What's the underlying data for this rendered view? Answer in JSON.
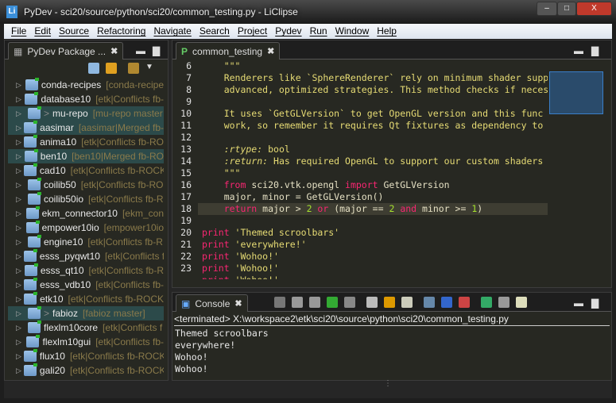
{
  "window": {
    "title": "PyDev - sci20/source/python/sci20/common_testing.py - LiClipse",
    "app_icon": "Li",
    "min": "–",
    "max": "□",
    "close": "X"
  },
  "menu": [
    "File",
    "Edit",
    "Source",
    "Refactoring",
    "Navigate",
    "Search",
    "Project",
    "Pydev",
    "Run",
    "Window",
    "Help"
  ],
  "explorer": {
    "title": "PyDev Package ...",
    "items": [
      {
        "name": "conda-recipes",
        "dec": "[conda-recipe"
      },
      {
        "name": "database10",
        "dec": "[etk|Conflicts fb-"
      },
      {
        "name": "mu-repo",
        "dec": "[mu-repo master",
        "sel": true,
        "gt": ">"
      },
      {
        "name": "aasimar",
        "dec": "[aasimar|Merged fb-",
        "sel": true
      },
      {
        "name": "anima10",
        "dec": "[etk|Conflicts fb-RO"
      },
      {
        "name": "ben10",
        "dec": "[ben10|Merged fb-RO",
        "sel": true
      },
      {
        "name": "cad10",
        "dec": "[etk|Conflicts fb-ROCK"
      },
      {
        "name": "coilib50",
        "dec": "[etk|Conflicts fb-RO"
      },
      {
        "name": "coilib50io",
        "dec": "[etk|Conflicts fb-R"
      },
      {
        "name": "ekm_connector10",
        "dec": "[ekm_con"
      },
      {
        "name": "empower10io",
        "dec": "[empower10io"
      },
      {
        "name": "engine10",
        "dec": "[etk|Conflicts fb-R"
      },
      {
        "name": "esss_pyqwt10",
        "dec": "[etk|Conflicts f"
      },
      {
        "name": "esss_qt10",
        "dec": "[etk|Conflicts fb-R"
      },
      {
        "name": "esss_vdb10",
        "dec": "[etk|Conflicts fb-"
      },
      {
        "name": "etk10",
        "dec": "[etk|Conflicts fb-ROCK"
      },
      {
        "name": "fabioz",
        "dec": "[fabioz master]",
        "sel": true,
        "gt": ">"
      },
      {
        "name": "flexlm10core",
        "dec": "[etk|Conflicts f"
      },
      {
        "name": "flexlm10gui",
        "dec": "[etk|Conflicts fb-"
      },
      {
        "name": "flux10",
        "dec": "[etk|Conflicts fb-ROCK"
      },
      {
        "name": "gali20",
        "dec": "[etk|Conflicts fb-ROCK"
      }
    ]
  },
  "editor": {
    "tab": "common_testing",
    "lines": [
      {
        "n": "6",
        "t": [
          [
            "doc",
            "    \"\"\""
          ]
        ]
      },
      {
        "n": "7",
        "t": [
          [
            "doc",
            "    Renderers like `SphereRenderer` rely on minimum shader supp"
          ]
        ]
      },
      {
        "n": "8",
        "t": [
          [
            "doc",
            "    advanced, optimized strategies. This method checks if neces"
          ]
        ]
      },
      {
        "n": "9",
        "t": []
      },
      {
        "n": "10",
        "t": [
          [
            "doc",
            "    It uses `GetGLVersion` to get OpenGL version and this func"
          ]
        ]
      },
      {
        "n": "11",
        "t": [
          [
            "doc",
            "    work, so remember it requires Qt fixtures as dependency to"
          ]
        ]
      },
      {
        "n": "12",
        "t": []
      },
      {
        "n": "13",
        "t": [
          [
            "it",
            "    :rtype:"
          ],
          [
            "doc",
            " bool"
          ]
        ]
      },
      {
        "n": "14",
        "t": [
          [
            "it",
            "    :return:"
          ],
          [
            "doc",
            " Has required OpenGL to support our custom shaders"
          ]
        ]
      },
      {
        "n": "15",
        "t": [
          [
            "doc",
            "    \"\"\""
          ]
        ]
      },
      {
        "n": "16",
        "t": [
          [
            "kw",
            "    from"
          ],
          [
            "id",
            " sci20.vtk.opengl "
          ],
          [
            "kw",
            "import"
          ],
          [
            "id",
            " GetGLVersion"
          ]
        ]
      },
      {
        "n": "17",
        "t": [
          [
            "id",
            "    major, minor = GetGLVersion()"
          ]
        ]
      },
      {
        "n": "18",
        "cur": true,
        "t": [
          [
            "kw",
            "    return"
          ],
          [
            "id",
            " major > "
          ],
          [
            "num",
            "2"
          ],
          [
            "kw",
            " or"
          ],
          [
            "id",
            " (major == "
          ],
          [
            "num",
            "2"
          ],
          [
            "kw",
            " and"
          ],
          [
            "id",
            " minor >= "
          ],
          [
            "num",
            "1"
          ],
          [
            "id",
            ")"
          ]
        ]
      },
      {
        "n": "19",
        "t": []
      },
      {
        "n": "20",
        "t": [
          [
            "kw",
            "print"
          ],
          [
            "str",
            " 'Themed scroolbars'"
          ]
        ]
      },
      {
        "n": "21",
        "t": [
          [
            "kw",
            "print"
          ],
          [
            "str",
            " 'everywhere!'"
          ]
        ]
      },
      {
        "n": "22",
        "t": [
          [
            "kw",
            "print"
          ],
          [
            "str",
            " 'Wohoo!'"
          ]
        ]
      },
      {
        "n": "23",
        "t": [
          [
            "kw",
            "print"
          ],
          [
            "str",
            " 'Wohoo!'"
          ]
        ]
      },
      {
        "n": "",
        "t": [
          [
            "kw",
            "print"
          ],
          [
            "str",
            " 'Wohoo!'"
          ]
        ]
      }
    ]
  },
  "console": {
    "tab": "Console",
    "terminated": "<terminated> X:\\workspace2\\etk\\sci20\\source\\python\\sci20\\common_testing.py",
    "output": [
      "Themed scroolbars",
      "everywhere!",
      "Wohoo!",
      "Wohoo!"
    ]
  },
  "colors": {
    "bg": "#272822",
    "keyword": "#f92672",
    "number": "#a6e22e",
    "string": "#e6db74",
    "selection": "#2c4a4a"
  }
}
